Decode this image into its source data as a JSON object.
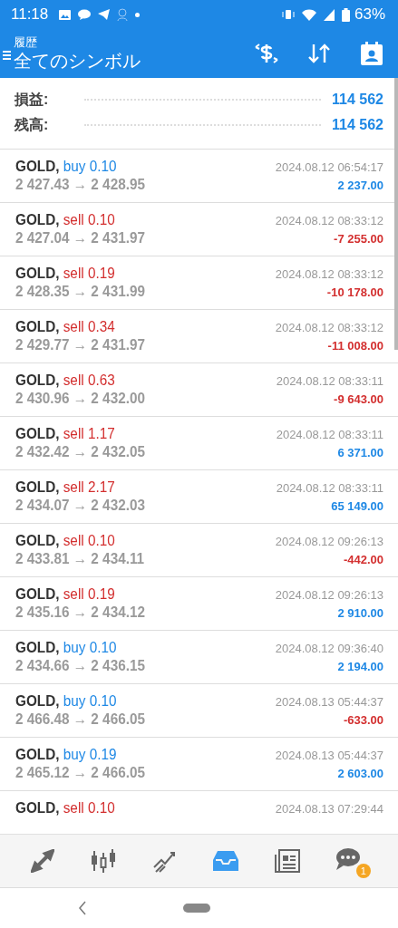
{
  "status_bar": {
    "time": "11:18",
    "battery": "63%"
  },
  "header": {
    "subtitle": "履歴",
    "title": "全てのシンボル"
  },
  "summary": [
    {
      "label": "損益:",
      "value": "114 562"
    },
    {
      "label": "残高:",
      "value": "114 562"
    }
  ],
  "deals": [
    {
      "symbol": "GOLD,",
      "kind": "buy",
      "side": "buy 0.10",
      "prices": "2 427.43 → 2 428.95",
      "time": "2024.08.12 06:54:17",
      "profit": "2 237.00",
      "loss": false
    },
    {
      "symbol": "GOLD,",
      "kind": "sell",
      "side": "sell 0.10",
      "prices": "2 427.04 → 2 431.97",
      "time": "2024.08.12 08:33:12",
      "profit": "-7 255.00",
      "loss": true
    },
    {
      "symbol": "GOLD,",
      "kind": "sell",
      "side": "sell 0.19",
      "prices": "2 428.35 → 2 431.99",
      "time": "2024.08.12 08:33:12",
      "profit": "-10 178.00",
      "loss": true
    },
    {
      "symbol": "GOLD,",
      "kind": "sell",
      "side": "sell 0.34",
      "prices": "2 429.77 → 2 431.97",
      "time": "2024.08.12 08:33:12",
      "profit": "-11 008.00",
      "loss": true
    },
    {
      "symbol": "GOLD,",
      "kind": "sell",
      "side": "sell 0.63",
      "prices": "2 430.96 → 2 432.00",
      "time": "2024.08.12 08:33:11",
      "profit": "-9 643.00",
      "loss": true
    },
    {
      "symbol": "GOLD,",
      "kind": "sell",
      "side": "sell 1.17",
      "prices": "2 432.42 → 2 432.05",
      "time": "2024.08.12 08:33:11",
      "profit": "6 371.00",
      "loss": false
    },
    {
      "symbol": "GOLD,",
      "kind": "sell",
      "side": "sell 2.17",
      "prices": "2 434.07 → 2 432.03",
      "time": "2024.08.12 08:33:11",
      "profit": "65 149.00",
      "loss": false
    },
    {
      "symbol": "GOLD,",
      "kind": "sell",
      "side": "sell 0.10",
      "prices": "2 433.81 → 2 434.11",
      "time": "2024.08.12 09:26:13",
      "profit": "-442.00",
      "loss": true
    },
    {
      "symbol": "GOLD,",
      "kind": "sell",
      "side": "sell 0.19",
      "prices": "2 435.16 → 2 434.12",
      "time": "2024.08.12 09:26:13",
      "profit": "2 910.00",
      "loss": false
    },
    {
      "symbol": "GOLD,",
      "kind": "buy",
      "side": "buy 0.10",
      "prices": "2 434.66 → 2 436.15",
      "time": "2024.08.12 09:36:40",
      "profit": "2 194.00",
      "loss": false
    },
    {
      "symbol": "GOLD,",
      "kind": "buy",
      "side": "buy 0.10",
      "prices": "2 466.48 → 2 466.05",
      "time": "2024.08.13 05:44:37",
      "profit": "-633.00",
      "loss": true
    },
    {
      "symbol": "GOLD,",
      "kind": "buy",
      "side": "buy 0.19",
      "prices": "2 465.12 → 2 466.05",
      "time": "2024.08.13 05:44:37",
      "profit": "2 603.00",
      "loss": false
    },
    {
      "symbol": "GOLD,",
      "kind": "sell",
      "side": "sell 0.10",
      "time": "2024.08.13 07:29:44"
    }
  ],
  "bottom_nav": [
    {
      "kind": "trade",
      "selected": false
    },
    {
      "kind": "chart",
      "selected": false
    },
    {
      "kind": "trend",
      "selected": false
    },
    {
      "kind": "inbox",
      "selected": true
    },
    {
      "kind": "news",
      "selected": false
    },
    {
      "kind": "chat",
      "selected": false,
      "badge": "1"
    }
  ]
}
